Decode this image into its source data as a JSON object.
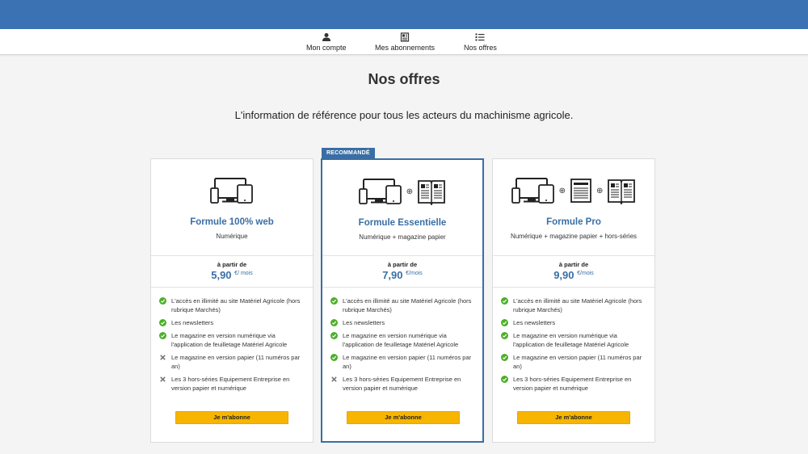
{
  "nav": {
    "items": [
      {
        "label": "Mon compte",
        "icon": "user-icon"
      },
      {
        "label": "Mes abonnements",
        "icon": "newspaper-icon"
      },
      {
        "label": "Nos offres",
        "icon": "list-icon"
      }
    ]
  },
  "page": {
    "title": "Nos offres",
    "subtitle": "L'information de référence pour tous les acteurs du machinisme agricole."
  },
  "badge": "RECOMMANDÉ",
  "colors": {
    "brand": "#3a72b4",
    "title_blue": "#3a6ea5",
    "cta": "#f7b500",
    "check": "#4caf2a",
    "cross": "#777777"
  },
  "offers": [
    {
      "title": "Formule 100% web",
      "desc": "Numérique",
      "from": "à partir de",
      "price": "5,90",
      "currency": "€",
      "per": "/ mois",
      "features": [
        {
          "text": "L'accès en illimité au site Matériel Agricole (hors rubrique Marchés)",
          "included": true
        },
        {
          "text": "Les newsletters",
          "included": true
        },
        {
          "text": "Le magazine en version numérique via l'application de feuilletage Matériel Agricole",
          "included": true
        },
        {
          "text": "Le magazine en version papier (11 numéros par an)",
          "included": false
        },
        {
          "text": "Les 3 hors-séries Equipement Entreprise en version papier et numérique",
          "included": false
        }
      ],
      "cta": "Je m'abonne"
    },
    {
      "title": "Formule Essentielle",
      "desc": "Numérique + magazine papier",
      "from": "à partir de",
      "price": "7,90",
      "currency": "€",
      "per": "/mois",
      "features": [
        {
          "text": "L'accès en illimité au site Matériel Agricole (hors rubrique Marchés)",
          "included": true
        },
        {
          "text": "Les newsletters",
          "included": true
        },
        {
          "text": "Le magazine en version numérique via l'application de feuilletage Matériel Agricole",
          "included": true
        },
        {
          "text": "Le magazine en version papier (11 numéros par an)",
          "included": true
        },
        {
          "text": "Les 3 hors-séries Equipement Entreprise en version papier et numérique",
          "included": false
        }
      ],
      "cta": "Je m'abonne"
    },
    {
      "title": "Formule Pro",
      "desc": "Numérique + magazine papier + hors-séries",
      "from": "à partir de",
      "price": "9,90",
      "currency": "€",
      "per": "/mois",
      "features": [
        {
          "text": "L'accès en illimité au site Matériel Agricole (hors rubrique Marchés)",
          "included": true
        },
        {
          "text": "Les newsletters",
          "included": true
        },
        {
          "text": "Le magazine en version numérique via l'application de feuilletage Matériel Agricole",
          "included": true
        },
        {
          "text": "Le magazine en version papier (11 numéros par an)",
          "included": true
        },
        {
          "text": "Les 3 hors-séries Equipement Entreprise en version papier et numérique",
          "included": true
        }
      ],
      "cta": "Je m'abonne"
    }
  ]
}
